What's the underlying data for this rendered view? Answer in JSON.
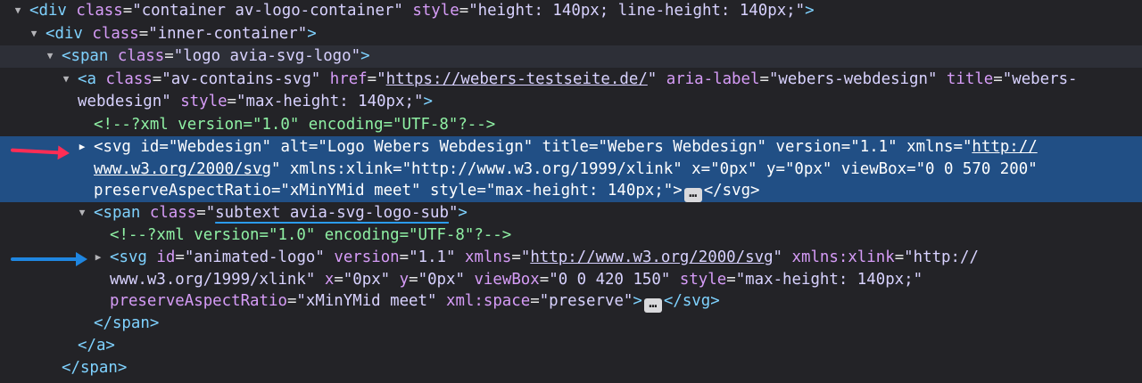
{
  "app": {
    "panel": "devtools-inspector",
    "accent_selected": "#214f85",
    "arrow_red": "#ff2d55",
    "arrow_blue": "#1f86e0"
  },
  "nodes": {
    "n1": {
      "open": "<div",
      "attr_class": "class",
      "val_class": "\"container av-logo-container\"",
      "attr_style": "style",
      "val_style": "\"height: 140px; line-height: 140px;\"",
      "close": ">"
    },
    "n2": {
      "open": "<div",
      "attr_class": "class",
      "val_class": "\"inner-container\"",
      "close": ">"
    },
    "n3": {
      "open": "<span",
      "attr_class": "class",
      "val_class": "\"logo avia-svg-logo\"",
      "close": ">"
    },
    "n4": {
      "open": "<a",
      "attr_class": "class",
      "val_class": "\"av-contains-svg\"",
      "attr_href": "href",
      "q": "\"",
      "val_href": "https://webers-testseite.de/",
      "attr_aria": "aria-label",
      "val_aria": "\"webers-webdesign\"",
      "attr_title": "title",
      "val_title_a": "\"webers-",
      "val_title_b": "webdesign\"",
      "attr_style": "style",
      "val_style": "\"max-height: 140px;\"",
      "close": ">"
    },
    "n5": {
      "comment": "<!--?xml version=\"1.0\" encoding=\"UTF-8\"?-->"
    },
    "n6": {
      "open": "<svg",
      "attr_id": "id",
      "val_id": "\"Webdesign\"",
      "attr_alt": "alt",
      "val_alt": "\"Logo Webers Webdesign\"",
      "attr_title": "title",
      "val_title": "\"Webers Webdesign\"",
      "attr_version": "version",
      "val_version": "\"1.1\"",
      "attr_xmlns": "xmlns",
      "q": "\"",
      "val_xmlns_a": "http://",
      "val_xmlns_b": "www.w3.org/2000/svg",
      "attr_xlink": "xmlns:xlink",
      "val_xlink": "\"http://www.w3.org/1999/xlink\"",
      "attr_x": "x",
      "val_x": "\"0px\"",
      "attr_y": "y",
      "val_y": "\"0px\"",
      "attr_viewbox": "viewBox",
      "val_viewbox": "\"0 0 570 200\"",
      "attr_par": "preserveAspectRatio",
      "val_par": "\"xMinYMid meet\"",
      "attr_style": "style",
      "val_style": "\"max-height: 140px;\"",
      "close": ">",
      "ellipsis": "…",
      "end": "</svg>"
    },
    "n7": {
      "open": "<span",
      "attr_class": "class",
      "q": "\"",
      "val_class": "subtext avia-svg-logo-sub",
      "close": ">"
    },
    "n8": {
      "comment": "<!--?xml version=\"1.0\" encoding=\"UTF-8\"?-->"
    },
    "n9": {
      "open": "<svg",
      "attr_id": "id",
      "val_id": "\"animated-logo\"",
      "attr_version": "version",
      "val_version": "\"1.1\"",
      "attr_xmlns": "xmlns",
      "q": "\"",
      "val_xmlns": "http://www.w3.org/2000/svg",
      "attr_xlink": "xmlns:xlink",
      "val_xlink_a": "\"http://",
      "val_xlink_b": "www.w3.org/1999/xlink\"",
      "attr_x": "x",
      "val_x": "\"0px\"",
      "attr_y": "y",
      "val_y": "\"0px\"",
      "attr_viewbox": "viewBox",
      "val_viewbox": "\"0 0 420 150\"",
      "attr_style": "style",
      "val_style": "\"max-height: 140px;\"",
      "attr_par": "preserveAspectRatio",
      "val_par": "\"xMinYMid meet\"",
      "attr_space": "xml:space",
      "val_space": "\"preserve\"",
      "close": ">",
      "ellipsis": "…",
      "end": "</svg>"
    },
    "n10": {
      "end": "</span>"
    },
    "n11": {
      "end": "</a>"
    },
    "n12": {
      "end": "</span>"
    }
  },
  "icons": {
    "expanded": "expanded-triangle-icon",
    "collapsed": "collapsed-triangle-icon",
    "ellipsis": "ellipsis-badge-icon",
    "arrow": "annotation-arrow-icon"
  },
  "glyphs": {
    "expanded": "▼",
    "collapsed_filled": "▶",
    "collapsed_outline": "▶"
  }
}
